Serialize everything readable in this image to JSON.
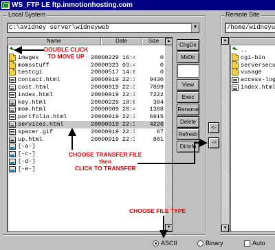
{
  "window": {
    "title": "WS_FTP LE ftp.inmotionhosting.com"
  },
  "local": {
    "label": "Local System",
    "path": "C:\\avidney server\\widneyweb",
    "columns": [
      "Name",
      "Date",
      "Size"
    ],
    "rows": [
      {
        "type": "up",
        "name": "",
        "date": "",
        "size": ""
      },
      {
        "type": "folder",
        "name": "images",
        "date": "20000229 16:4",
        "size": "0"
      },
      {
        "type": "folder",
        "name": "momsstuff",
        "date": "20000323 03:4",
        "size": "0"
      },
      {
        "type": "folder",
        "name": "testcgi",
        "date": "20000517 14:0",
        "size": "0"
      },
      {
        "type": "file",
        "name": "contact.html",
        "date": "20000919 22:3",
        "size": "9430"
      },
      {
        "type": "file",
        "name": "cost.html",
        "date": "20000919 22:3",
        "size": "7899"
      },
      {
        "type": "file",
        "name": "index.html",
        "date": "20000919 22:3",
        "size": "7222"
      },
      {
        "type": "file",
        "name": "key.html",
        "date": "20000229 18:0",
        "size": "384"
      },
      {
        "type": "file",
        "name": "mom.html",
        "date": "20000909 20:4",
        "size": "1368"
      },
      {
        "type": "file",
        "name": "portfolio.html",
        "date": "20000919 22:3",
        "size": "6915"
      },
      {
        "type": "file",
        "name": "services.html",
        "date": "20000919 22:3",
        "size": "4226",
        "selected": true
      },
      {
        "type": "file",
        "name": "spacer.gif",
        "date": "20000919 22:3",
        "size": "67"
      },
      {
        "type": "file",
        "name": "up.html",
        "date": "20000919 22:3",
        "size": "881"
      },
      {
        "type": "drive",
        "name": "[-a-]",
        "date": "",
        "size": ""
      },
      {
        "type": "drive",
        "name": "[-c-]",
        "date": "",
        "size": ""
      },
      {
        "type": "drive",
        "name": "[-d-]",
        "date": "",
        "size": ""
      },
      {
        "type": "drive",
        "name": "[-e-]",
        "date": "",
        "size": ""
      }
    ],
    "buttons": [
      "ChgDir",
      "MkDir",
      "",
      "View",
      "Exec",
      "Rename",
      "Delete",
      "Refresh",
      "DirInfo"
    ]
  },
  "remote": {
    "label": "Remote Site",
    "path": "/home/widneyu",
    "rows": [
      {
        "type": "up",
        "name": ".."
      },
      {
        "type": "folder",
        "name": "cgi-bin"
      },
      {
        "type": "folder",
        "name": "serversecur"
      },
      {
        "type": "folder",
        "name": "vusage"
      },
      {
        "type": "file",
        "name": "access-log"
      },
      {
        "type": "file",
        "name": "index.html"
      }
    ]
  },
  "transfer": {
    "left_arrow": "<-",
    "right_arrow": "->"
  },
  "mode": {
    "ascii": "ASCII",
    "binary": "Binary",
    "auto": "Auto",
    "selected": "ASCII"
  },
  "annotations": {
    "double_click": "DOUBLE CLICK\nTO MOVE UP",
    "choose_transfer": "CHOOSE TRANSFER FILE\nthen\nCLICK TO TRANSFER",
    "choose_type": "CHOOSE FILE TYPE"
  },
  "colors": {
    "titlebar": "#000080",
    "annotation": "#e00000"
  }
}
